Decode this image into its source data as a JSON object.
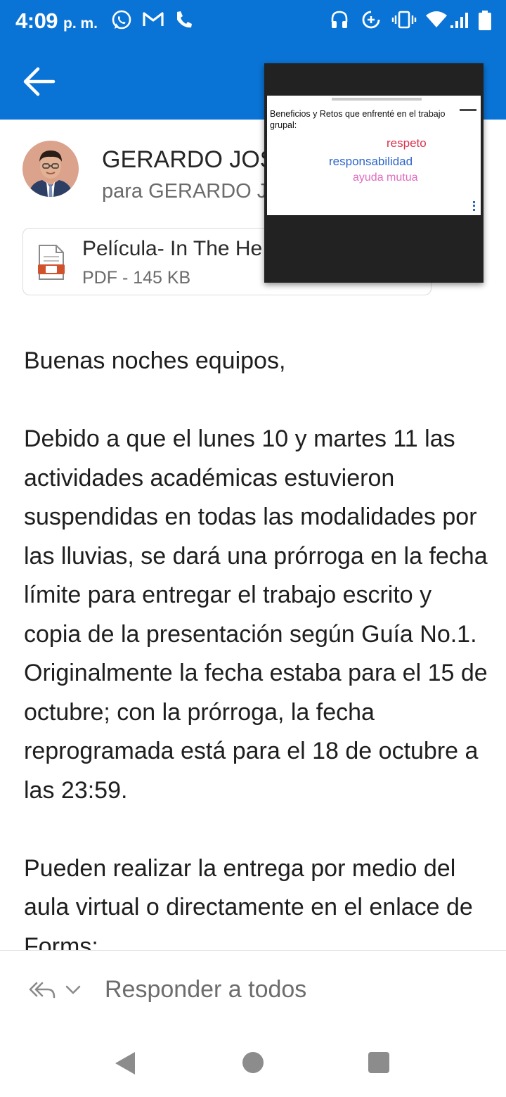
{
  "status_bar": {
    "time": "4:09",
    "ampm": "p. m.",
    "icons": [
      "whatsapp-icon",
      "gmail-icon",
      "phone-icon",
      "headset-icon",
      "data-saver-icon",
      "vibrate-icon",
      "wifi-icon",
      "signal-icon",
      "battery-icon"
    ]
  },
  "colors": {
    "app_blue": "#0a74d6",
    "slide_red": "#d9314e",
    "slide_blue": "#2c66c9",
    "slide_pink": "#e06bbd"
  },
  "header": {
    "back_icon": "arrow-left-icon"
  },
  "sender": {
    "name": "GERARDO JOS",
    "recipient": "para GERARDO J"
  },
  "attachment": {
    "name": "Película- In The He",
    "meta": "PDF - 145 KB",
    "icon": "pdf-file-icon"
  },
  "pip_slide": {
    "title": "Beneficios y Retos que enfrenté en el trabajo grupal:",
    "words": [
      "respeto",
      "responsabilidad",
      "ayuda mutua"
    ]
  },
  "body": {
    "greeting": "Buenas noches equipos,",
    "paragraph1": "Debido a que el lunes 10 y martes 11 las actividades académicas estuvieron suspendidas en todas las modalidades por las lluvias, se dará una prórroga en la fecha límite para entregar el trabajo escrito y copia de la presentación según Guía No.1.  Originalmente la fecha estaba para el 15 de octubre; con la prórroga, la fecha reprogramada está para el 18 de octubre a las 23:59.",
    "paragraph2": "Pueden realizar la entrega por medio del aula virtual o directamente en el enlace de Forms:"
  },
  "reply_bar": {
    "label": "Responder a todos"
  },
  "nav_bar": {
    "buttons": [
      "back-triangle-icon",
      "home-circle-icon",
      "recents-square-icon"
    ]
  }
}
